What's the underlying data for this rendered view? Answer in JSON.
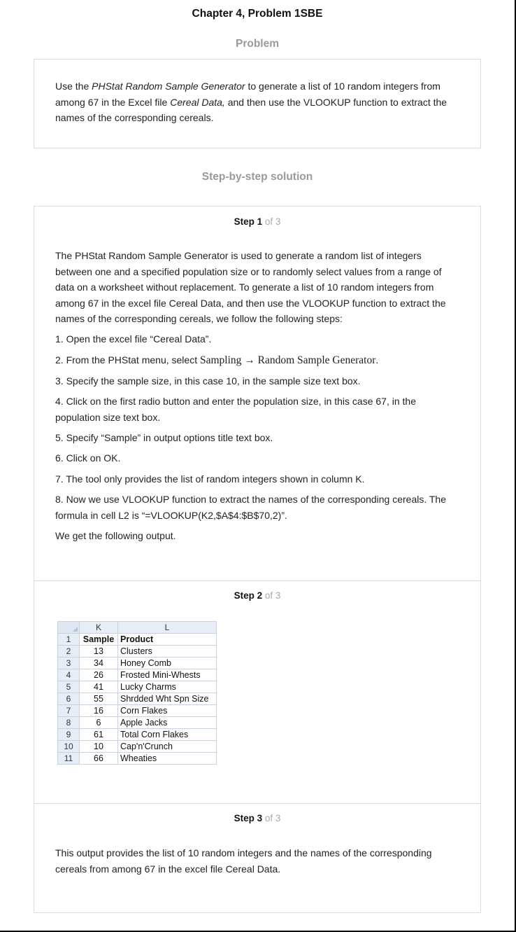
{
  "title": "Chapter 4, Problem 1SBE",
  "problem": {
    "heading": "Problem",
    "text_parts": [
      "Use the ",
      "PHStat Random Sample Generator",
      " to generate a list of 10 random integers from among 67 in the Excel file ",
      "Cereal Data,",
      " and then use the VLOOKUP function to extract the names of the corresponding cereals."
    ]
  },
  "solution_heading": "Step-by-step solution",
  "steps": [
    {
      "label": "Step 1",
      "of": "of 3",
      "intro": "The PHStat Random Sample Generator is used to generate a random list of integers between one and a specified population size or to randomly select values from a range of data on a worksheet without replacement. To generate a list of 10 random integers from among 67 in the excel file Cereal Data, and then use the VLOOKUP function to extract the names of the corresponding cereals, we follow the following steps:",
      "item1": "1. Open the excel file “Cereal Data”.",
      "item2_prefix": "2. From the PHStat menu, select ",
      "item2_formula": "Sampling → Random Sample Generator",
      "item2_suffix": ".",
      "item3": "3. Specify the sample size, in this case 10, in the sample size text box.",
      "item4": "4. Click on the first radio button and enter the population size, in this case 67, in the population size text box.",
      "item5": "5. Specify “Sample” in output options title text box.",
      "item6": "6. Click on OK.",
      "item7": "7. The tool only provides the list of random integers shown in column K.",
      "item8": "8. Now we use VLOOKUP function to extract the names of the corresponding cereals. The formula in cell L2 is “=VLOOKUP(K2,$A$4:$B$70,2)”.",
      "outro": "We get the following output."
    },
    {
      "label": "Step 2",
      "of": "of 3",
      "sheet": {
        "col_headers": [
          "K",
          "L"
        ],
        "rows": [
          {
            "n": "1",
            "k": "Sample",
            "l": "Product"
          },
          {
            "n": "2",
            "k": "13",
            "l": "Clusters"
          },
          {
            "n": "3",
            "k": "34",
            "l": "Honey Comb"
          },
          {
            "n": "4",
            "k": "26",
            "l": "Frosted Mini-Whests"
          },
          {
            "n": "5",
            "k": "41",
            "l": "Lucky Charms"
          },
          {
            "n": "6",
            "k": "55",
            "l": "Shrdded Wht Spn Size"
          },
          {
            "n": "7",
            "k": "16",
            "l": "Corn Flakes"
          },
          {
            "n": "8",
            "k": "6",
            "l": "Apple Jacks"
          },
          {
            "n": "9",
            "k": "61",
            "l": "Total Corn Flakes"
          },
          {
            "n": "10",
            "k": "10",
            "l": "Cap'n'Crunch"
          },
          {
            "n": "11",
            "k": "66",
            "l": "Wheaties"
          }
        ]
      }
    },
    {
      "label": "Step 3",
      "of": "of 3",
      "text": "This output provides the list of 10 random integers and the names of the corresponding cereals from among 67 in the excel file Cereal Data."
    }
  ]
}
